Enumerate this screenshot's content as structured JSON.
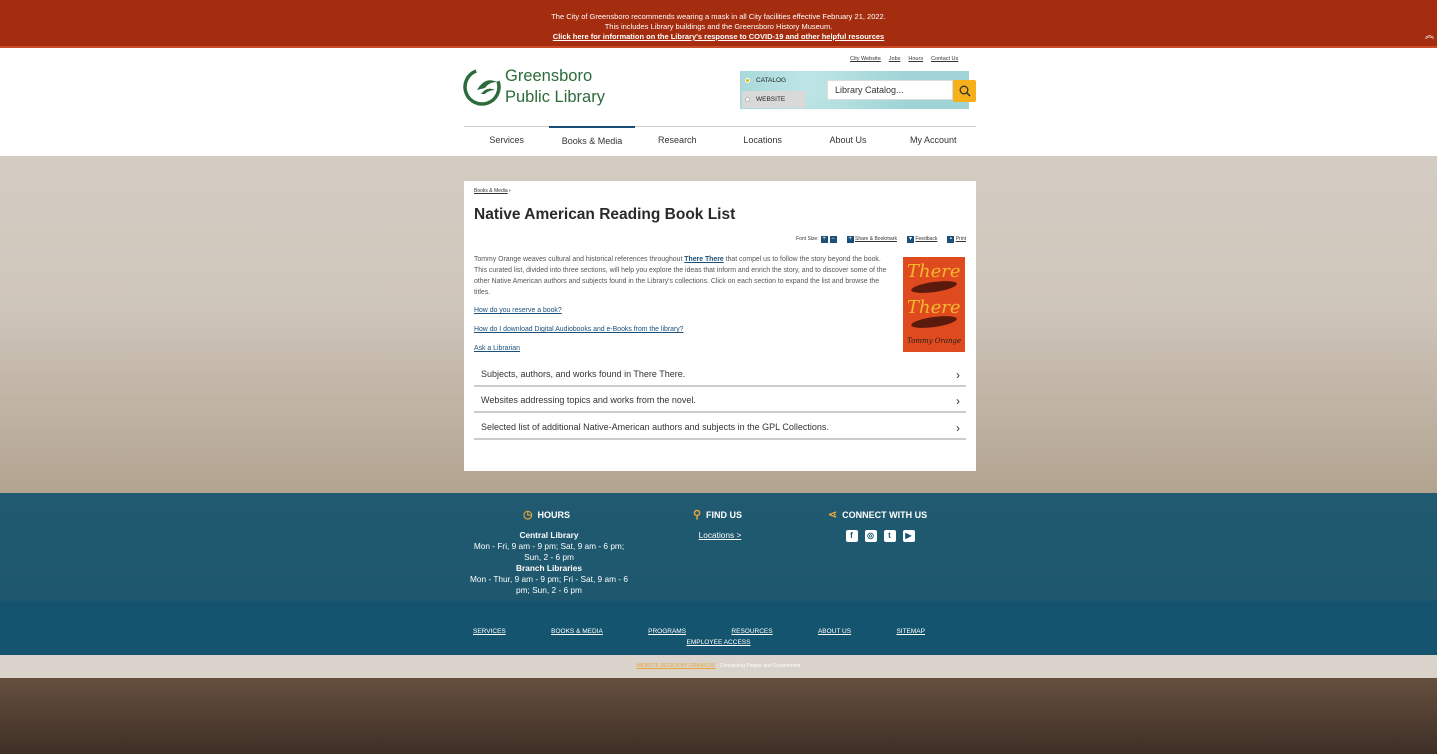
{
  "alert": {
    "line1": "The City of Greensboro recommends wearing a mask in all City facilities effective February 21, 2022.",
    "line2": "This includes Library buildings and the Greensboro History Museum.",
    "line3": "Click here for information on the Library's response to COVID-19 and other helpful resources",
    "collapse": "«"
  },
  "header": {
    "logo_line1": "Greensboro",
    "logo_line2": "Public Library",
    "toplinks": [
      "City Website",
      "Jobs",
      "Hours",
      "Contact Us"
    ],
    "search": {
      "option1": "CATALOG",
      "option2": "WEBSITE",
      "placeholder": "Library Catalog..."
    }
  },
  "nav": [
    "Services",
    "Books & Media",
    "Research",
    "Locations",
    "About Us",
    "My Account"
  ],
  "page": {
    "breadcrumb": "Books & Media",
    "breadcrumb_sep": "›",
    "title": "Native American Reading Book List",
    "font_size_label": "Font Size:",
    "font_plus": "+",
    "font_minus": "−",
    "share": "Share & Bookmark",
    "feedback": "Feedback",
    "print": "Print",
    "intro_a": "Tommy Orange weaves cultural and historical references throughout ",
    "intro_book": "There There",
    "intro_b": " that compel us to follow the story beyond the book. This curated list, divided into three sections, will help you explore the ideas that inform and enrich the story, and to discover some of the other Native American authors and subjects found in the Library's collections. Click on each section to expand the list and browse the titles.",
    "link1": "How do you reserve a book?",
    "link2": "How do I download Digital Audiobooks and e-Books from the library?",
    "link3": "Ask a Librarian",
    "cover": {
      "t1": "There",
      "t2": "There",
      "author": "Tommy Orange"
    },
    "accordions": [
      "Subjects, authors, and works found in There There.",
      "Websites addressing topics and works from the novel.",
      "Selected list of additional Native-American authors and subjects in the GPL Collections."
    ]
  },
  "footer": {
    "hours_title": "HOURS",
    "central": "Central Library",
    "central_hours": "Mon - Fri, 9 am - 9 pm; Sat, 9 am - 6 pm; Sun, 2 - 6 pm",
    "branch": "Branch Libraries",
    "branch_hours": "Mon - Thur, 9 am - 9 pm; Fri - Sat, 9 am - 6 pm; Sun, 2 - 6 pm",
    "find_title": "FIND US",
    "locations": "Locations >",
    "connect_title": "CONNECT WITH US",
    "links": [
      "SERVICES",
      "BOOKS & MEDIA",
      "PROGRAMS",
      "RESOURCES",
      "ABOUT US",
      "SITEMAP"
    ],
    "employee": "EMPLOYEE ACCESS",
    "credit1": "WEBSITE DESIGN BY GRANICUS",
    "credit2": " - Connecting People and Government"
  }
}
